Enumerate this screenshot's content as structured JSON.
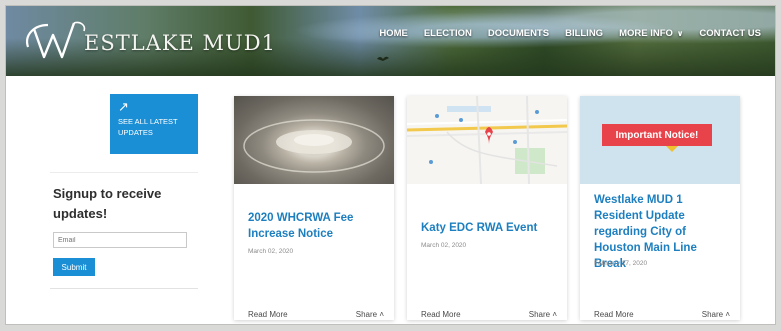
{
  "brand": {
    "name": "ESTLAKE MUD1",
    "initial": "W"
  },
  "nav": {
    "items": [
      {
        "label": "HOME"
      },
      {
        "label": "ELECTION"
      },
      {
        "label": "DOCUMENTS"
      },
      {
        "label": "BILLING"
      },
      {
        "label": "MORE INFO"
      },
      {
        "label": "CONTACT US"
      }
    ]
  },
  "sidebar": {
    "see_all_label": "SEE ALL LATEST UPDATES",
    "signup_title": "Signup to receive updates!",
    "email_placeholder": "Email",
    "submit_label": "Submit"
  },
  "cards": [
    {
      "title": "2020 WHCRWA Fee Increase Notice",
      "date": "March 02, 2020",
      "read_more": "Read More",
      "share": "Share"
    },
    {
      "title": "Katy EDC RWA Event",
      "date": "March 02, 2020",
      "read_more": "Read More",
      "share": "Share"
    },
    {
      "title": "Westlake MUD 1 Resident Update regarding City of Houston Main Line Break",
      "date": "February 27, 2020",
      "read_more": "Read More",
      "share": "Share"
    }
  ],
  "notice_image_text": "Important Notice!",
  "colors": {
    "accent": "#1b8fd6",
    "title_link": "#1d7fbf",
    "notice_red": "#e8434a"
  },
  "icons": {
    "see_all": "arrow-up-right-icon",
    "share": "chevron-icon",
    "more_info": "chevron-down-icon"
  }
}
